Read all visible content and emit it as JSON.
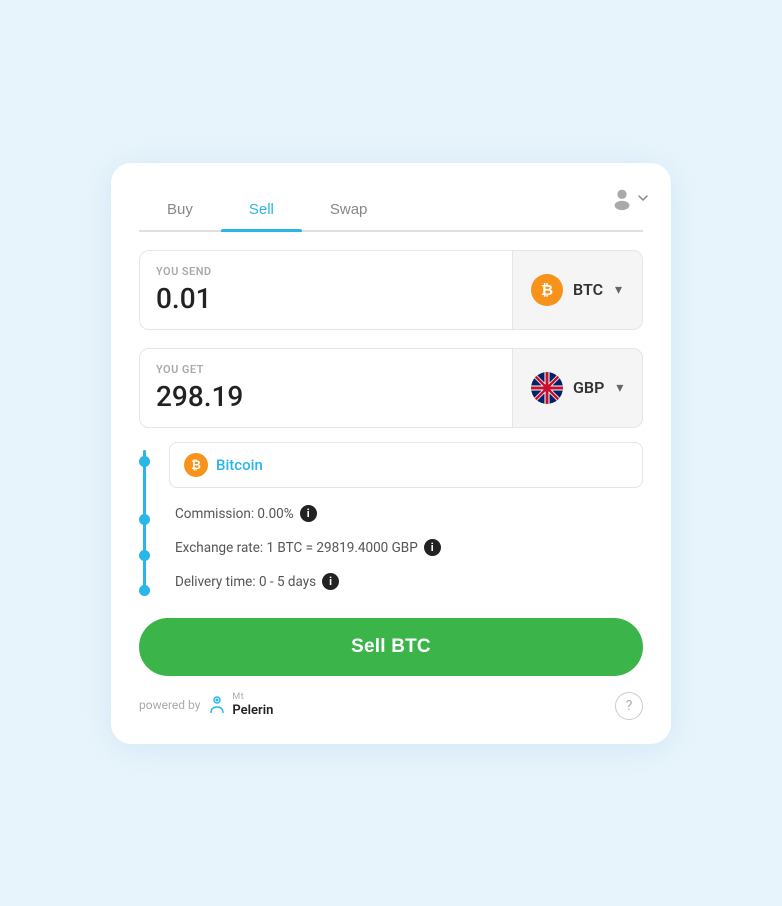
{
  "tabs": [
    {
      "label": "Buy",
      "active": false
    },
    {
      "label": "Sell",
      "active": true
    },
    {
      "label": "Swap",
      "active": false
    }
  ],
  "send": {
    "label": "YOU SEND",
    "value": "0.01",
    "currency_code": "BTC",
    "currency_icon": "₿"
  },
  "get": {
    "label": "YOU GET",
    "value": "298.19",
    "currency_code": "GBP"
  },
  "suggestion": {
    "label": "Bitcoin"
  },
  "info": {
    "commission": "Commission: 0.00%",
    "exchange_rate": "Exchange rate: 1 BTC = 29819.4000 GBP",
    "delivery_time": "Delivery time: 0 - 5 days"
  },
  "sell_button": {
    "label": "Sell BTC"
  },
  "footer": {
    "powered_by": "powered by",
    "brand": "Mt\nPelerin"
  },
  "icons": {
    "user": "user-icon",
    "info": "ℹ",
    "question": "?",
    "btc": "₿",
    "dropdown": "▾"
  }
}
